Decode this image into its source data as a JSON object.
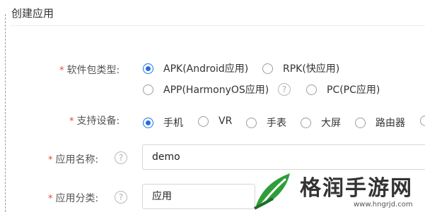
{
  "header": {
    "title": "创建应用"
  },
  "form": {
    "package_type": {
      "required": "*",
      "label": "软件包类型:",
      "options": [
        {
          "label": "APK(Android应用)",
          "checked": true
        },
        {
          "label": "RPK(快应用)",
          "checked": false
        },
        {
          "label": "APP(HarmonyOS应用)",
          "checked": false
        },
        {
          "label": "PC(PC应用)",
          "checked": false
        }
      ],
      "help": "?"
    },
    "devices": {
      "required": "*",
      "label": "支持设备:",
      "options": [
        {
          "label": "手机",
          "checked": true
        },
        {
          "label": "VR",
          "checked": false
        },
        {
          "label": "手表",
          "checked": false
        },
        {
          "label": "大屏",
          "checked": false
        },
        {
          "label": "路由器",
          "checked": false
        }
      ]
    },
    "app_name": {
      "required": "*",
      "label": "应用名称:",
      "value": "demo",
      "help": "?"
    },
    "app_category": {
      "required": "*",
      "label": "应用分类:",
      "value": "应用",
      "help": "?"
    }
  },
  "watermark": {
    "text": "格润手游网",
    "url": "www.hngrjd.com"
  },
  "colors": {
    "accent": "#1f6fe5",
    "required": "#e04a3b",
    "watermark_green": "#2f9e3a"
  }
}
